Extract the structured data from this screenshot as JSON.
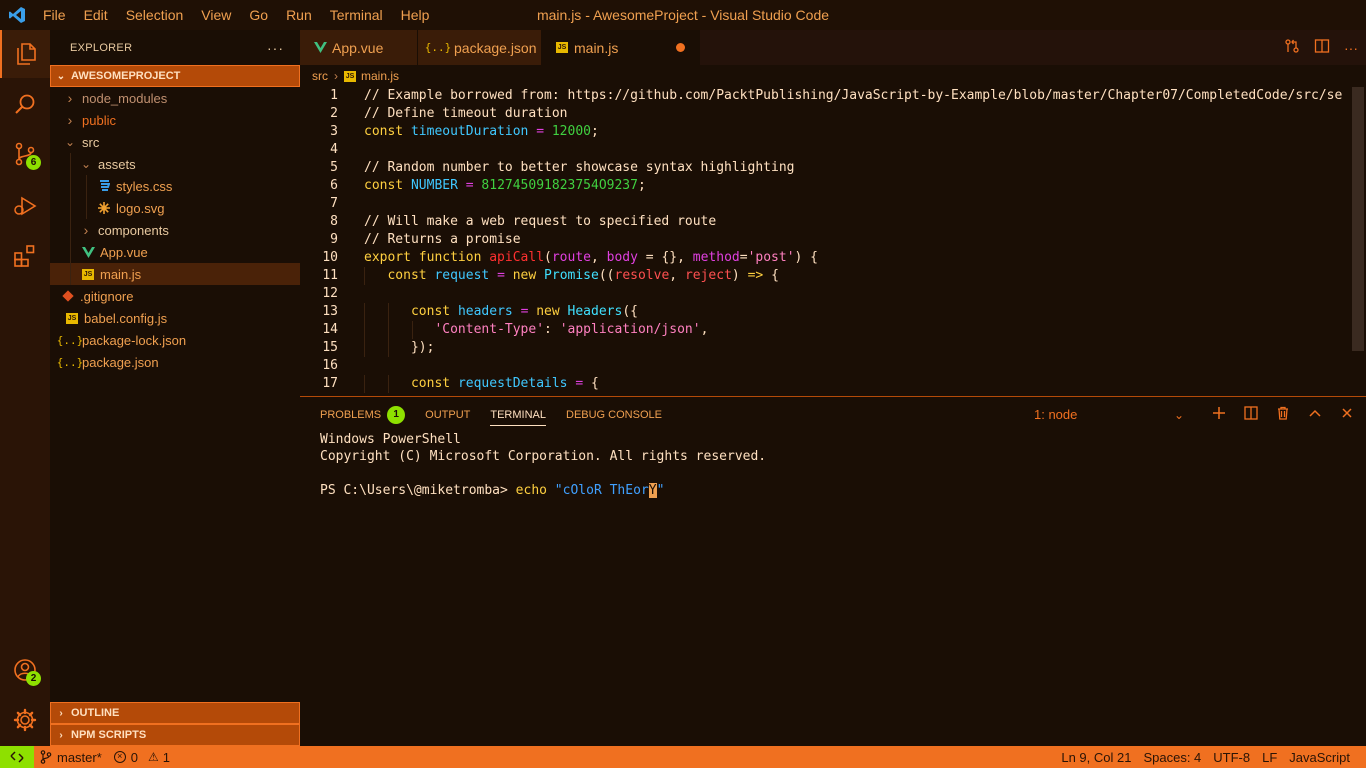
{
  "window": {
    "title": "main.js - AwesomeProject - Visual Studio Code"
  },
  "menu": [
    "File",
    "Edit",
    "Selection",
    "View",
    "Go",
    "Run",
    "Terminal",
    "Help"
  ],
  "activity": {
    "source_control_badge": "6",
    "accounts_badge": "2"
  },
  "sidebar": {
    "title": "EXPLORER",
    "more": "···",
    "root": "AWESOMEPROJECT",
    "tree": [
      {
        "label": "node_modules",
        "type": "folder",
        "depth": 0,
        "open": false
      },
      {
        "label": "public",
        "type": "folder",
        "depth": 0,
        "open": false
      },
      {
        "label": "src",
        "type": "folder",
        "depth": 0,
        "open": true
      },
      {
        "label": "assets",
        "type": "folder",
        "depth": 1,
        "open": true
      },
      {
        "label": "styles.css",
        "type": "css",
        "depth": 2
      },
      {
        "label": "logo.svg",
        "type": "svg",
        "depth": 2
      },
      {
        "label": "components",
        "type": "folder",
        "depth": 1,
        "open": false
      },
      {
        "label": "App.vue",
        "type": "vue",
        "depth": 1
      },
      {
        "label": "main.js",
        "type": "js",
        "depth": 1,
        "selected": true
      },
      {
        "label": ".gitignore",
        "type": "git",
        "depth": 0
      },
      {
        "label": "babel.config.js",
        "type": "js",
        "depth": 0
      },
      {
        "label": "package-lock.json",
        "type": "json",
        "depth": 0
      },
      {
        "label": "package.json",
        "type": "json",
        "depth": 0
      }
    ],
    "outline": "OUTLINE",
    "npm_scripts": "NPM SCRIPTS"
  },
  "tabs": [
    {
      "label": "App.vue",
      "type": "vue"
    },
    {
      "label": "package.json",
      "type": "json"
    },
    {
      "label": "main.js",
      "type": "js",
      "active": true,
      "modified": true
    }
  ],
  "breadcrumb": {
    "folder": "src",
    "file": "main.js"
  },
  "editor": {
    "lines": [
      {
        "n": "1",
        "tokens": [
          [
            "c-com",
            "// Example borrowed from: https://github.com/PacktPublishing/JavaScript-by-Example/blob/master/Chapter07/CompletedCode/src/se"
          ]
        ]
      },
      {
        "n": "2",
        "tokens": [
          [
            "c-com",
            "// Define timeout duration"
          ]
        ]
      },
      {
        "n": "3",
        "tokens": [
          [
            "c-kw",
            "const "
          ],
          [
            "c-var",
            "timeoutDuration "
          ],
          [
            "c-op",
            "= "
          ],
          [
            "c-num",
            "12000"
          ],
          [
            "c-plain",
            ";"
          ]
        ]
      },
      {
        "n": "4",
        "tokens": []
      },
      {
        "n": "5",
        "tokens": [
          [
            "c-com",
            "// Random number to better showcase syntax highlighting"
          ]
        ]
      },
      {
        "n": "6",
        "tokens": [
          [
            "c-kw",
            "const "
          ],
          [
            "c-var",
            "NUMBER "
          ],
          [
            "c-op",
            "= "
          ],
          [
            "c-num",
            "812745091823754O9237"
          ],
          [
            "c-plain",
            ";"
          ]
        ]
      },
      {
        "n": "7",
        "tokens": []
      },
      {
        "n": "8",
        "tokens": [
          [
            "c-com",
            "// Will make a web request to specified route"
          ]
        ]
      },
      {
        "n": "9",
        "tokens": [
          [
            "c-com",
            "// Returns a promise"
          ]
        ]
      },
      {
        "n": "10",
        "tokens": [
          [
            "c-kw",
            "export function "
          ],
          [
            "c-fn",
            "apiCall"
          ],
          [
            "c-plain",
            "("
          ],
          [
            "c-op",
            "route"
          ],
          [
            "c-plain",
            ", "
          ],
          [
            "c-op",
            "body "
          ],
          [
            "c-plain",
            "= {}, "
          ],
          [
            "c-op",
            "method"
          ],
          [
            "c-plain",
            "="
          ],
          [
            "c-str",
            "'post'"
          ],
          [
            "c-plain",
            ") {"
          ]
        ]
      },
      {
        "n": "11",
        "tokens": [
          [
            "c-plain",
            "   "
          ],
          [
            "c-kw",
            "const "
          ],
          [
            "c-var",
            "request "
          ],
          [
            "c-op",
            "= "
          ],
          [
            "c-kw",
            "new "
          ],
          [
            "c-cls",
            "Promise"
          ],
          [
            "c-plain",
            "(("
          ],
          [
            "c-param",
            "resolve"
          ],
          [
            "c-plain",
            ", "
          ],
          [
            "c-param",
            "reject"
          ],
          [
            "c-plain",
            ") "
          ],
          [
            "c-kw",
            "=> "
          ],
          [
            "c-plain",
            "{"
          ]
        ]
      },
      {
        "n": "12",
        "tokens": []
      },
      {
        "n": "13",
        "tokens": [
          [
            "c-plain",
            "      "
          ],
          [
            "c-kw",
            "const "
          ],
          [
            "c-var",
            "headers "
          ],
          [
            "c-op",
            "= "
          ],
          [
            "c-kw",
            "new "
          ],
          [
            "c-cls",
            "Headers"
          ],
          [
            "c-plain",
            "({"
          ]
        ]
      },
      {
        "n": "14",
        "tokens": [
          [
            "c-plain",
            "         "
          ],
          [
            "c-str",
            "'Content-Type'"
          ],
          [
            "c-plain",
            ": "
          ],
          [
            "c-str",
            "'application/json'"
          ],
          [
            "c-plain",
            ","
          ]
        ]
      },
      {
        "n": "15",
        "tokens": [
          [
            "c-plain",
            "      });"
          ]
        ]
      },
      {
        "n": "16",
        "tokens": []
      },
      {
        "n": "17",
        "tokens": [
          [
            "c-plain",
            "      "
          ],
          [
            "c-kw",
            "const "
          ],
          [
            "c-var",
            "requestDetails "
          ],
          [
            "c-op",
            "= "
          ],
          [
            "c-plain",
            "{"
          ]
        ]
      }
    ]
  },
  "panel": {
    "tabs": [
      {
        "label": "PROBLEMS",
        "badge": "1"
      },
      {
        "label": "OUTPUT"
      },
      {
        "label": "TERMINAL",
        "active": true
      },
      {
        "label": "DEBUG CONSOLE"
      }
    ],
    "terminal_select": "1: node",
    "terminal": {
      "line1": "Windows PowerShell",
      "line2": "Copyright (C) Microsoft Corporation. All rights reserved.",
      "prompt": "PS C:\\Users\\@miketromba> ",
      "command": "echo",
      "arg_before_cursor": " \"cOloR ThEor",
      "cursor_char": "Y",
      "arg_after_cursor": "\""
    }
  },
  "status": {
    "branch": "master*",
    "errors": "0",
    "warnings": "1",
    "position": "Ln 9, Col 21",
    "spaces": "Spaces: 4",
    "encoding": "UTF-8",
    "eol": "LF",
    "language": "JavaScript"
  },
  "colors": {
    "accent": "#f07020",
    "badge": "#8ee000",
    "background": "#1a0e05"
  }
}
